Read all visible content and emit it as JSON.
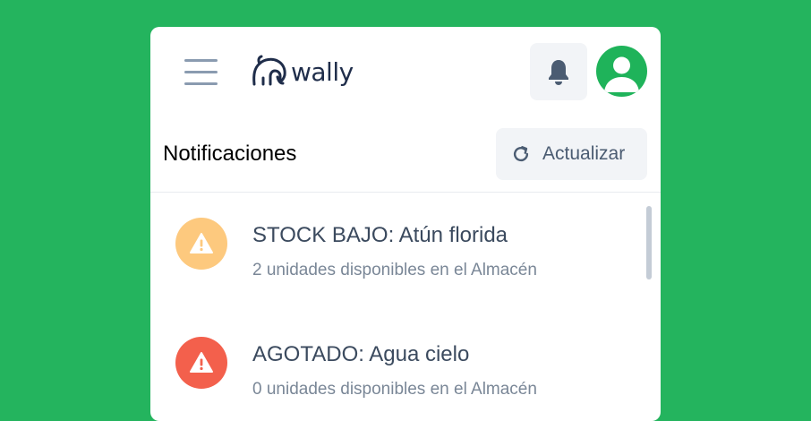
{
  "header": {
    "brand": "wally",
    "menu_icon": "hamburger-menu-icon",
    "logo_icon": "elephant-logo-icon",
    "bell_icon": "bell-icon",
    "avatar_icon": "user-avatar-icon"
  },
  "page": {
    "title": "Notificaciones",
    "refresh_label": "Actualizar",
    "refresh_icon": "refresh-icon"
  },
  "notifications": [
    {
      "title": "STOCK BAJO: Atún florida",
      "subtitle": "2 unidades disponibles en el Almacén",
      "icon": "warning-icon",
      "color": "#fdc97e"
    },
    {
      "title": "AGOTADO: Agua cielo",
      "subtitle": "0 unidades disponibles en el Almacén",
      "icon": "warning-icon",
      "color": "#f3604c"
    }
  ],
  "colors": {
    "background": "#24b45e",
    "brand_text": "#1f2d4a",
    "avatar": "#1fb35a"
  }
}
